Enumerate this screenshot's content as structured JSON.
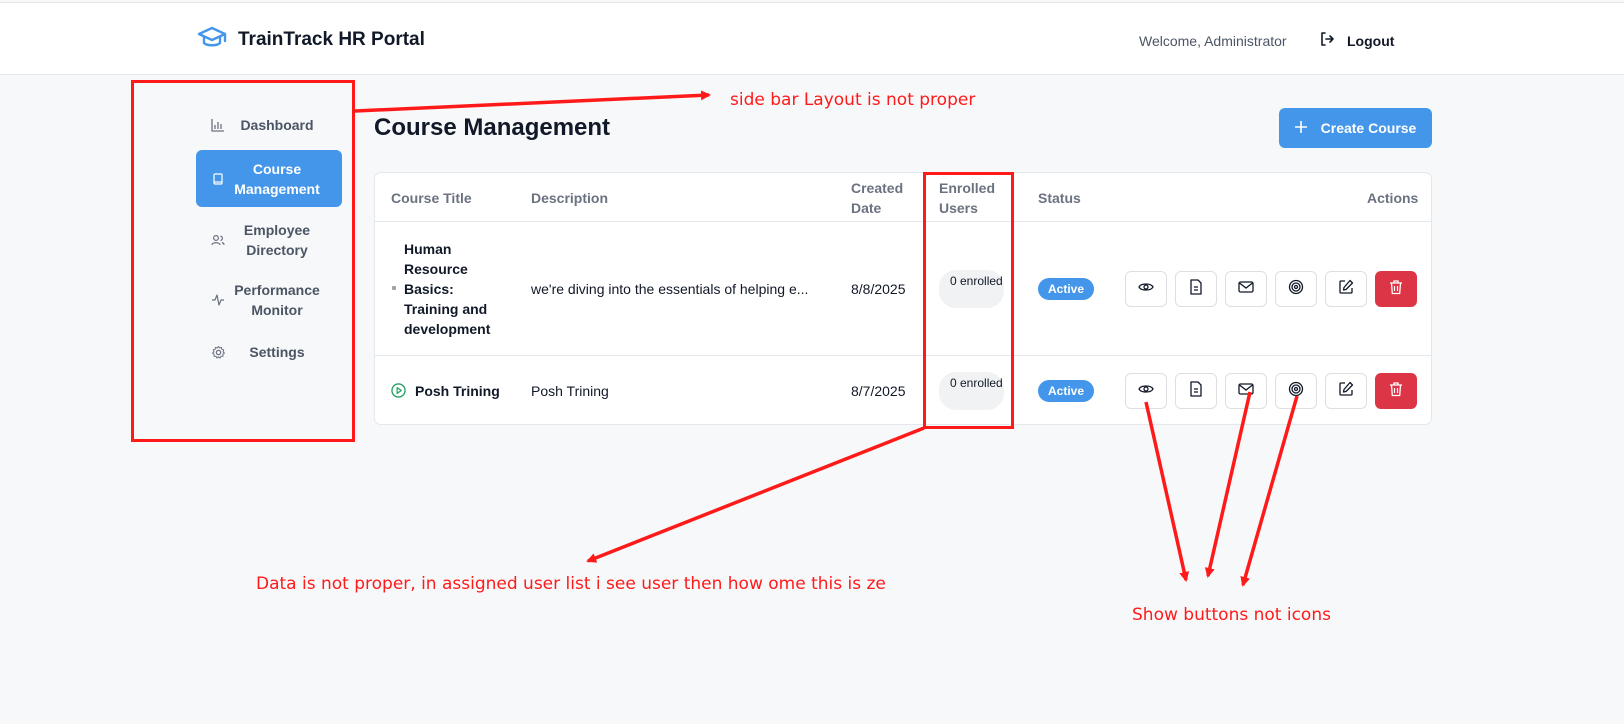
{
  "header": {
    "brand_title": "TrainTrack HR Portal",
    "welcome_text": "Welcome, Administrator",
    "logout_label": "Logout",
    "brand_icon": "graduation-cap-icon",
    "accent_color": "#4496ea"
  },
  "sidebar": {
    "items": [
      {
        "label": "Dashboard",
        "icon": "bar-chart-icon",
        "active": false
      },
      {
        "label": "Course Management",
        "icon": "book-icon",
        "active": true
      },
      {
        "label": "Employee Directory",
        "icon": "users-icon",
        "active": false
      },
      {
        "label": "Performance Monitor",
        "icon": "activity-icon",
        "active": false
      },
      {
        "label": "Settings",
        "icon": "gear-icon",
        "active": false
      }
    ]
  },
  "main": {
    "page_title": "Course Management",
    "create_button_label": "Create Course",
    "table": {
      "columns": [
        "Course Title",
        "Description",
        "Created Date",
        "Enrolled Users",
        "Status",
        "Actions"
      ],
      "rows": [
        {
          "title": "Human Resource Basics: Training and development",
          "description": "we're diving into the essentials of helping e...",
          "created_date": "8/8/2025",
          "enrolled": "0 enrolled",
          "status": "Active"
        },
        {
          "title": "Posh Trining",
          "description": "Posh Trining",
          "created_date": "8/7/2025",
          "enrolled": "0 enrolled",
          "status": "Active"
        }
      ],
      "action_icons": [
        "eye-icon",
        "document-icon",
        "mail-icon",
        "target-icon",
        "edit-icon",
        "trash-icon"
      ],
      "danger_color": "#dc3545"
    }
  },
  "annotations": {
    "sidebar_note": "side bar Layout is not proper",
    "data_note": "Data is not proper, in assigned user list i see user then how ome this is ze",
    "buttons_note": "Show buttons not icons",
    "color": "#ff1a1a"
  }
}
